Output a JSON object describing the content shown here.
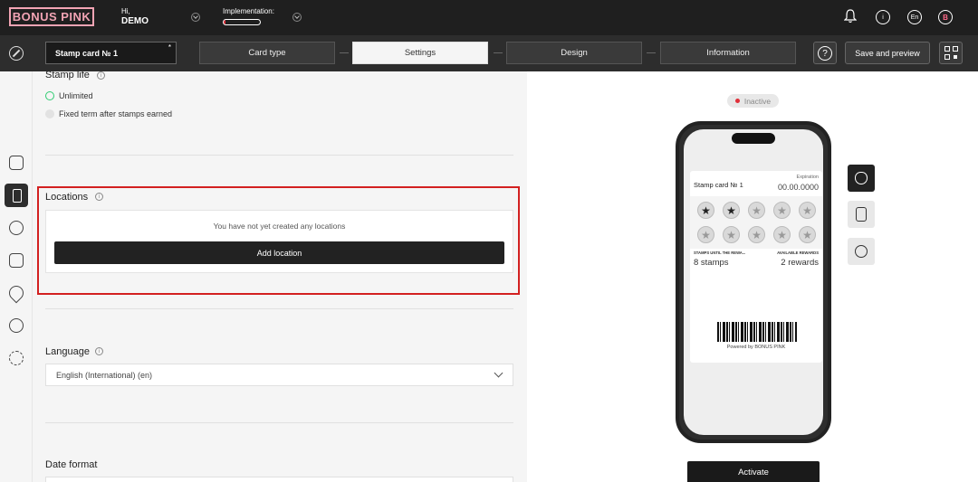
{
  "brand": {
    "logo_text": "BONUS PINK",
    "accent": "#f2a4b4"
  },
  "user": {
    "greeting": "Hi,",
    "name": "DEMO",
    "avatar_letter": "B"
  },
  "implementation": {
    "label": "Implementation:",
    "progress": 0.05,
    "progress_color": "#e0303a"
  },
  "header_icons": {
    "bell": "bell-icon",
    "info": "info-icon",
    "language": "En"
  },
  "editor": {
    "card_name": "Stamp card № 1",
    "required_mark": "*",
    "steps": [
      "Card type",
      "Settings",
      "Design",
      "Information"
    ],
    "active_step": "Settings",
    "help_label": "?",
    "save_label": "Save and preview"
  },
  "settings": {
    "stamp_life": {
      "title": "Stamp life",
      "options": [
        "Unlimited",
        "Fixed term after stamps earned"
      ],
      "selected": "Unlimited"
    },
    "locations": {
      "title": "Locations",
      "empty_text": "You have not yet created any locations",
      "add_label": "Add location"
    },
    "language": {
      "title": "Language",
      "selected": "English (International) (en)"
    },
    "date_format": {
      "title": "Date format"
    }
  },
  "preview": {
    "status": "Inactive",
    "status_color": "#e0303a",
    "card": {
      "title": "Stamp card № 1",
      "expiration_label": "Expiration",
      "expiration_value": "00.00.0000",
      "stamps_total": 10,
      "stamps_filled": 2,
      "until_reward_label": "STAMPS UNTIL THE REWA...",
      "until_reward_value": "8 stamps",
      "available_label": "AVAILABLE REWARDS",
      "available_value": "2 rewards",
      "powered_by": "Powered by BONUS PINK"
    },
    "activate_label": "Activate"
  }
}
